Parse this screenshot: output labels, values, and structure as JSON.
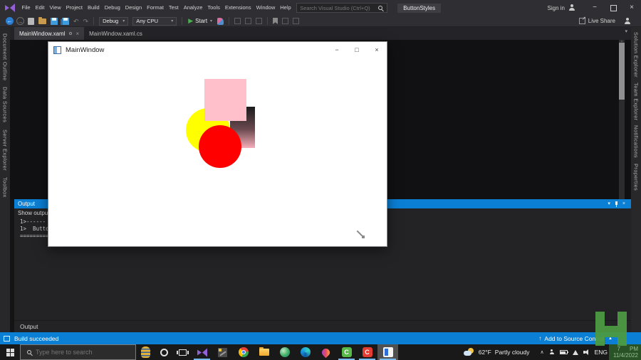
{
  "titlebar": {
    "menus": [
      "File",
      "Edit",
      "View",
      "Project",
      "Build",
      "Debug",
      "Design",
      "Format",
      "Test",
      "Analyze",
      "Tools",
      "Extensions",
      "Window",
      "Help"
    ],
    "search_placeholder": "Search Visual Studio (Ctrl+Q)",
    "project_badge": "ButtonStyles",
    "sign_in_label": "Sign in"
  },
  "toolbar": {
    "config": "Debug",
    "platform": "Any CPU",
    "start_label": "Start",
    "live_share_label": "Live Share"
  },
  "editor": {
    "tabs": [
      {
        "label": "MainWindow.xaml",
        "active": true
      },
      {
        "label": "MainWindow.xaml.cs",
        "active": false
      }
    ]
  },
  "left_rail": {
    "items": [
      "Document Outline",
      "Data Sources",
      "Server Explorer",
      "Toolbox"
    ]
  },
  "right_rail": {
    "items": [
      "Solution Explorer",
      "Team Explorer",
      "Notifications",
      "Properties"
    ]
  },
  "app_window": {
    "title": "MainWindow",
    "shape_colors": {
      "pink_square": "#FFC0CB",
      "yellow_circle": "#FFFF00",
      "red_circle": "#FF0000",
      "gradient_rect_top": "#1B1B1B",
      "gradient_rect_bottom": "#F6AEB9"
    }
  },
  "output": {
    "panel_title": "Output",
    "show_output_label": "Show output",
    "lines": [
      "1>------ B",
      "1>  Button",
      "=========="
    ],
    "bottom_tab_label": "Output"
  },
  "status_bar": {
    "build_status": "Build succeeded",
    "source_control_label": "Add to Source Control"
  },
  "taskbar": {
    "search_placeholder": "Type here to search",
    "green_c_letter": "C",
    "red_c_letter": "C",
    "weather_temp": "62°F",
    "weather_condition": "Partly cloudy",
    "language": "ENG",
    "clock_hour": "7",
    "clock_meridiem": "PM",
    "clock_date": "11/4/2022"
  },
  "icons": {
    "chevron_down": "▾",
    "play": "▶",
    "back": "←",
    "forward": "→",
    "undo": "↶",
    "redo": "↷",
    "minimize": "−",
    "maximize": "□",
    "close": "×",
    "up_arrow": "↑",
    "triangle_up": "▲",
    "share_arrow": "↗",
    "tray_chevron": "∧",
    "scroll_up": "▲"
  },
  "accent_colors": {
    "vs_blue": "#0A7FD4",
    "start_green": "#48B14E",
    "watermark_green": "#4C9A43",
    "taskbar_underline": "#76B9ED"
  }
}
